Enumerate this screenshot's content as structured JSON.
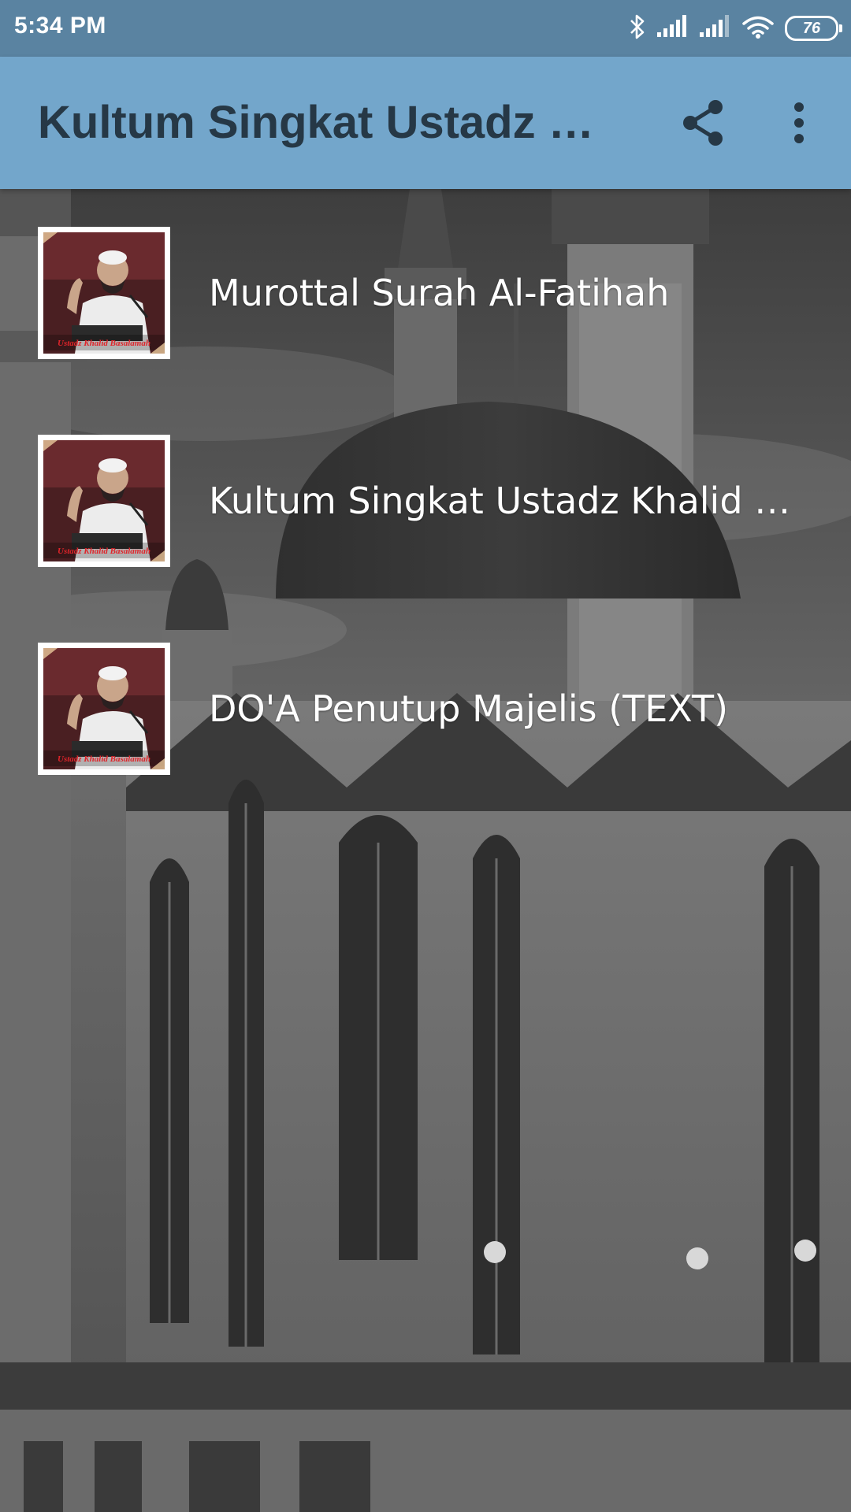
{
  "status_bar": {
    "time": "5:34 PM",
    "battery_level": "76",
    "icons": [
      "bluetooth-icon",
      "signal-icon",
      "signal-icon",
      "wifi-icon",
      "battery-icon"
    ]
  },
  "app_bar": {
    "title": "Kultum Singkat Ustadz Khalid Basalamah",
    "actions": [
      "share-icon",
      "more-vert-icon"
    ]
  },
  "thumbnail_caption": "Ustadz Khalid Basalamah",
  "list": {
    "items": [
      {
        "label": "Murottal Surah Al-Fatihah"
      },
      {
        "label": "Kultum Singkat Ustadz Khalid Basalamah"
      },
      {
        "label": "DO'A Penutup Majelis (TEXT)"
      }
    ]
  },
  "colors": {
    "status_bar": "#5a83a1",
    "app_bar": "#73a6cb",
    "title_text": "#263846",
    "list_text": "#ffffff"
  }
}
